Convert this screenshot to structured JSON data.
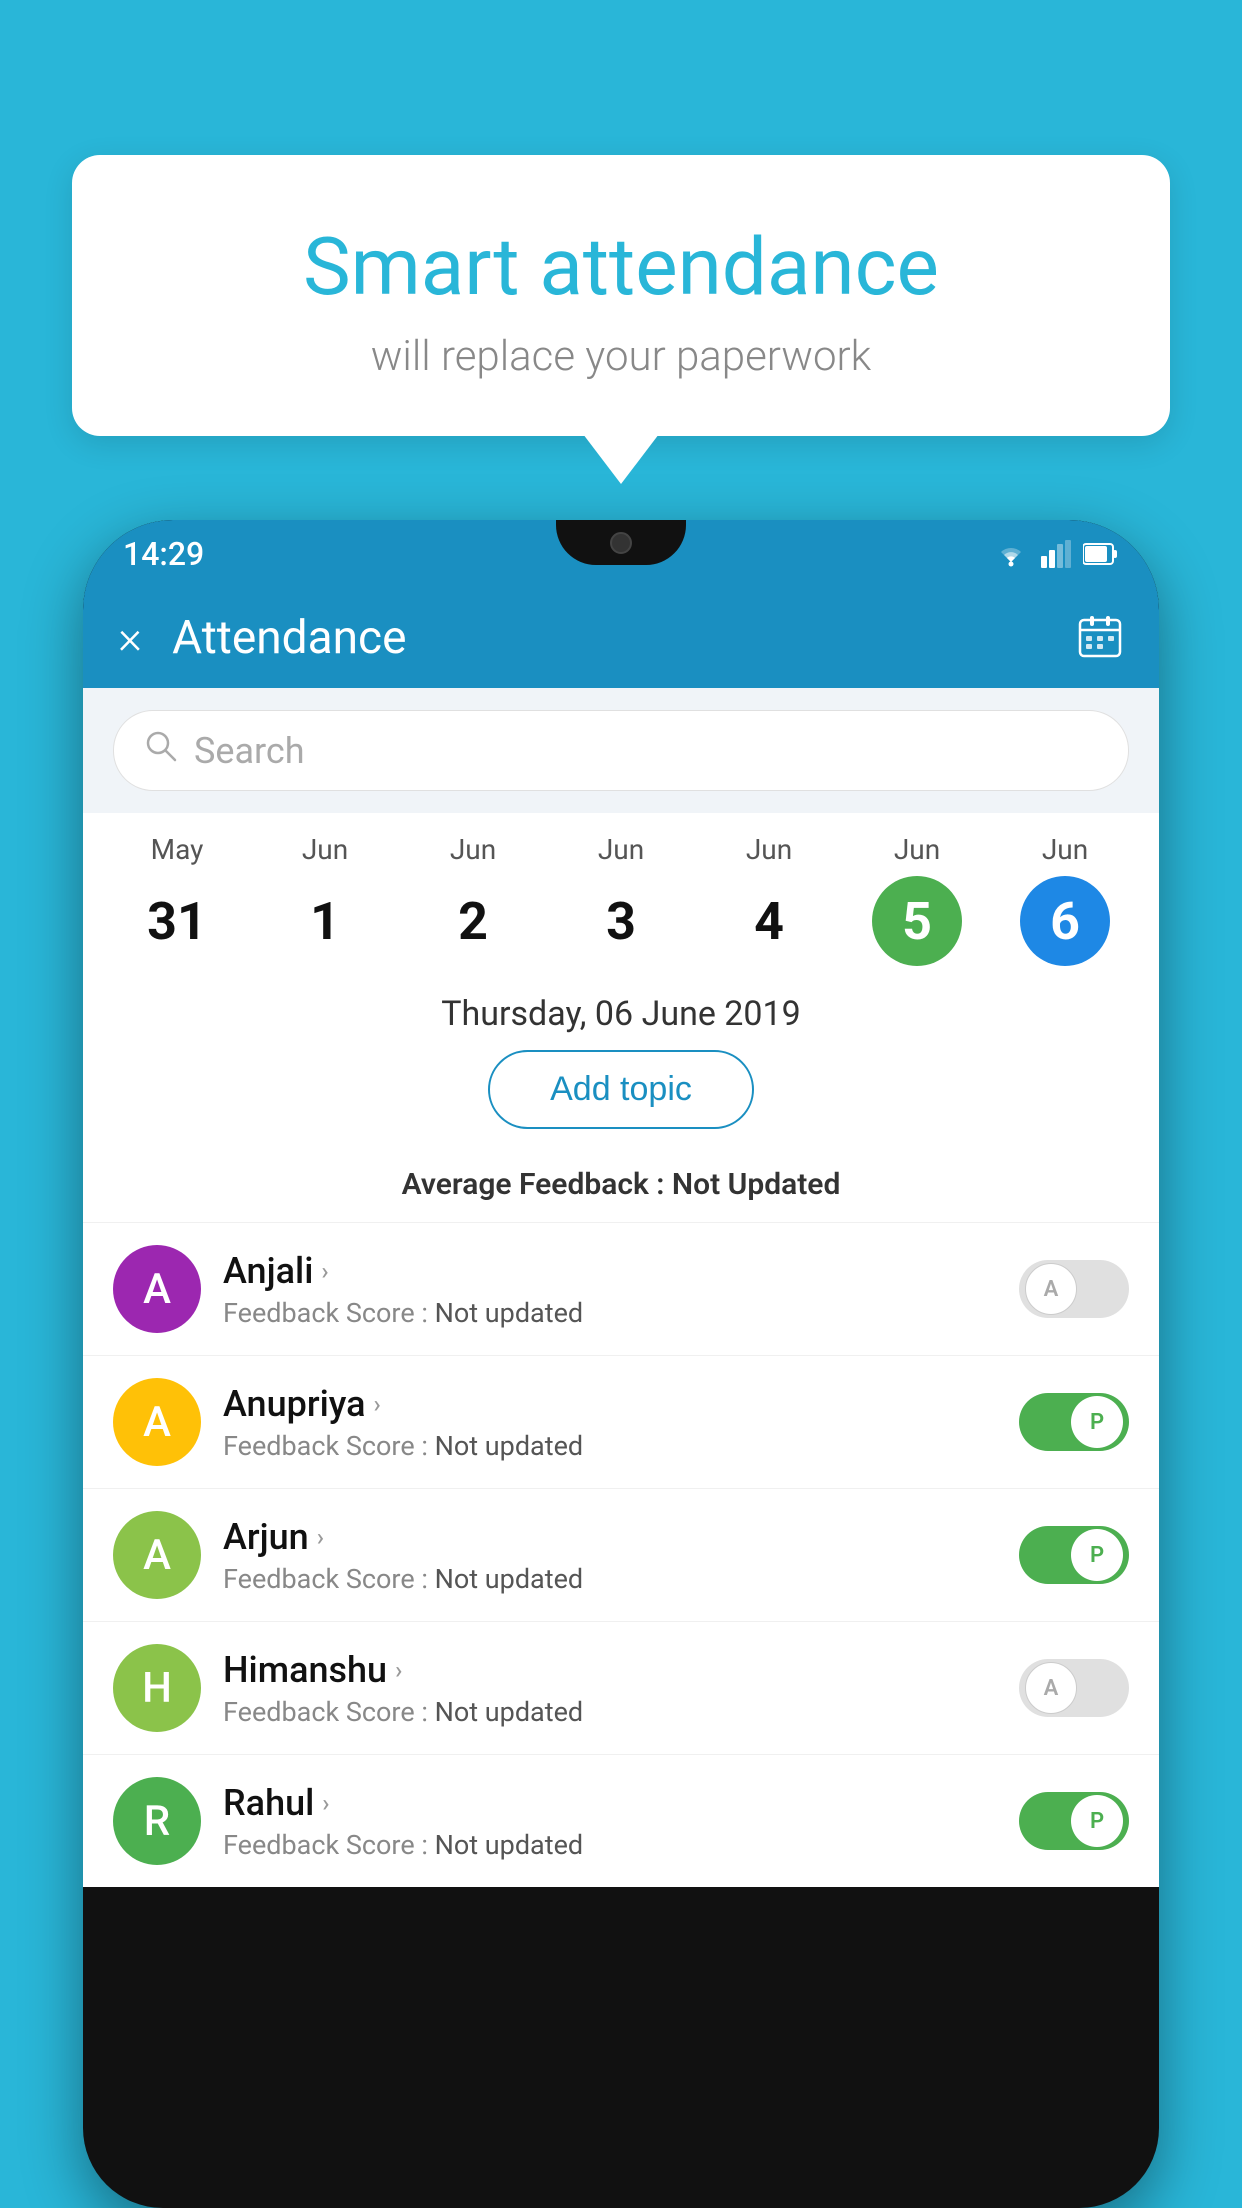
{
  "background_color": "#29b6d8",
  "speech_bubble": {
    "title": "Smart attendance",
    "subtitle": "will replace your paperwork"
  },
  "phone": {
    "status_bar": {
      "time": "14:29"
    },
    "app_bar": {
      "title": "Attendance",
      "close_label": "×",
      "calendar_label": "📅"
    },
    "search": {
      "placeholder": "Search"
    },
    "calendar": {
      "days": [
        {
          "month": "May",
          "date": "31",
          "style": "normal"
        },
        {
          "month": "Jun",
          "date": "1",
          "style": "normal"
        },
        {
          "month": "Jun",
          "date": "2",
          "style": "normal"
        },
        {
          "month": "Jun",
          "date": "3",
          "style": "normal"
        },
        {
          "month": "Jun",
          "date": "4",
          "style": "normal"
        },
        {
          "month": "Jun",
          "date": "5",
          "style": "green"
        },
        {
          "month": "Jun",
          "date": "6",
          "style": "blue"
        }
      ]
    },
    "selected_date": "Thursday, 06 June 2019",
    "add_topic_btn": "Add topic",
    "avg_feedback_label": "Average Feedback : ",
    "avg_feedback_value": "Not Updated",
    "students": [
      {
        "name": "Anjali",
        "feedback_label": "Feedback Score : ",
        "feedback_value": "Not updated",
        "avatar_letter": "A",
        "avatar_color": "#9c27b0",
        "attendance": "absent"
      },
      {
        "name": "Anupriya",
        "feedback_label": "Feedback Score : ",
        "feedback_value": "Not updated",
        "avatar_letter": "A",
        "avatar_color": "#ffc107",
        "attendance": "present"
      },
      {
        "name": "Arjun",
        "feedback_label": "Feedback Score : ",
        "feedback_value": "Not updated",
        "avatar_letter": "A",
        "avatar_color": "#8bc34a",
        "attendance": "present"
      },
      {
        "name": "Himanshu",
        "feedback_label": "Feedback Score : ",
        "feedback_value": "Not updated",
        "avatar_letter": "H",
        "avatar_color": "#8bc34a",
        "attendance": "absent"
      },
      {
        "name": "Rahul",
        "feedback_label": "Feedback Score : ",
        "feedback_value": "Not updated",
        "avatar_letter": "R",
        "avatar_color": "#4caf50",
        "attendance": "present"
      }
    ]
  }
}
